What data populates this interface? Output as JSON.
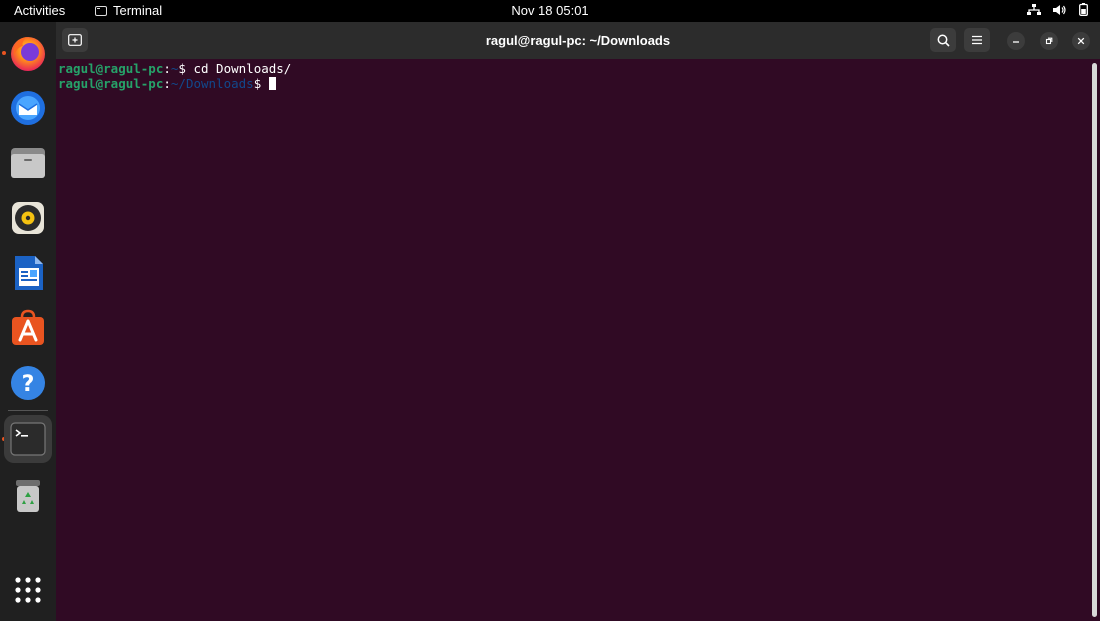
{
  "topbar": {
    "activities": "Activities",
    "app_name": "Terminal",
    "clock": "Nov 18  05:01"
  },
  "window": {
    "title": "ragul@ragul-pc: ~/Downloads"
  },
  "terminal": {
    "lines": [
      {
        "user": "ragul@ragul-pc",
        "path": "~",
        "prompt": "$",
        "command": "cd Downloads/"
      },
      {
        "user": "ragul@ragul-pc",
        "path": "~/Downloads",
        "prompt": "$",
        "command": ""
      }
    ]
  },
  "dock": {
    "items": [
      {
        "name": "firefox",
        "icon": "firefox-icon",
        "running": true
      },
      {
        "name": "thunderbird",
        "icon": "thunderbird-icon",
        "running": false
      },
      {
        "name": "files",
        "icon": "files-icon",
        "running": false
      },
      {
        "name": "rhythmbox",
        "icon": "rhythmbox-icon",
        "running": false
      },
      {
        "name": "libreoffice-writer",
        "icon": "writer-icon",
        "running": false
      },
      {
        "name": "app-center",
        "icon": "app-center-icon",
        "running": false
      },
      {
        "name": "help",
        "icon": "help-icon",
        "running": false
      },
      {
        "name": "terminal",
        "icon": "terminal-icon",
        "running": true
      },
      {
        "name": "trash",
        "icon": "trash-icon",
        "running": false
      },
      {
        "name": "show-apps",
        "icon": "app-grid-icon",
        "running": false
      }
    ]
  },
  "colors": {
    "terminal_bg": "#300a24",
    "prompt_user": "#26a269",
    "prompt_path": "#12488b",
    "accent": "#e95420"
  }
}
